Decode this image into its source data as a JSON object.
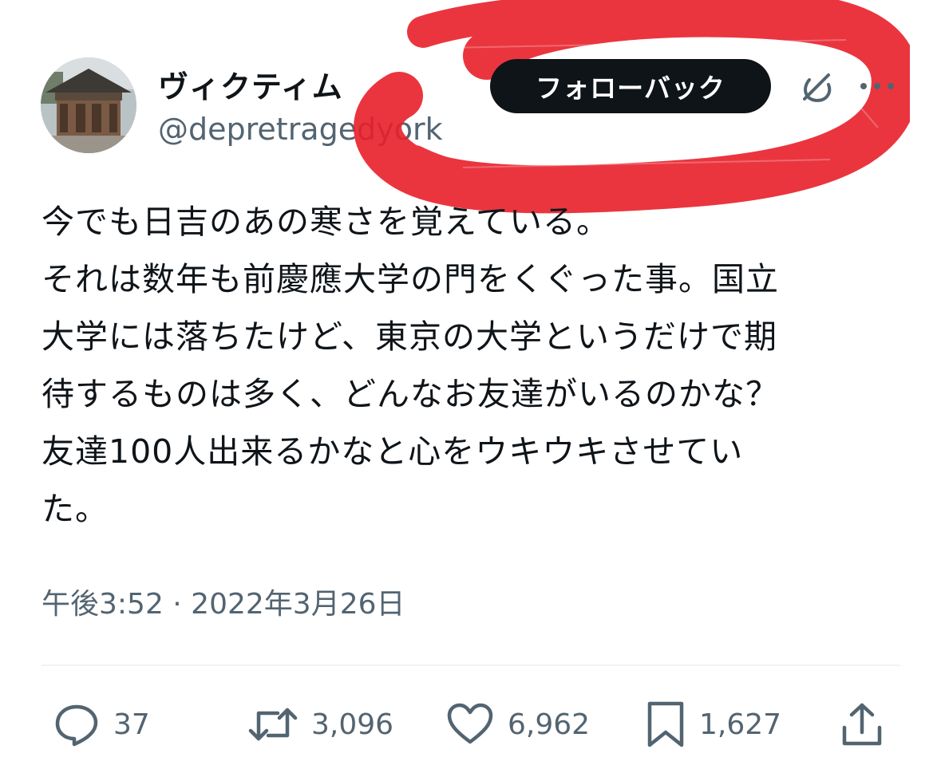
{
  "user": {
    "display_name": "ヴィクティム",
    "handle": "@depretragedyork"
  },
  "follow_button": {
    "label": "フォローバック"
  },
  "tweet": {
    "lines": [
      "今でも日吉のあの寒さを覚えている。",
      "それは数年も前慶應大学の門をくぐった事。国立",
      "大学には落ちたけど、東京の大学というだけで期",
      "待するものは多く、どんなお友達がいるのかな？",
      "友達100人出来るかなと心をウキウキさせてい",
      "た。"
    ],
    "timestamp": "午後3:52 · 2022年3月26日"
  },
  "actions": {
    "reply": {
      "icon": "reply-icon",
      "count": "37"
    },
    "retweet": {
      "icon": "retweet-icon",
      "count": "3,096"
    },
    "like": {
      "icon": "heart-icon",
      "count": "6,962"
    },
    "bookmark": {
      "icon": "bookmark-icon",
      "count": "1,627"
    },
    "share": {
      "icon": "share-icon"
    }
  },
  "colors": {
    "text": "#0f1419",
    "secondary": "#536471",
    "button_bg": "#0f1419",
    "scribble": "#e8202b"
  }
}
